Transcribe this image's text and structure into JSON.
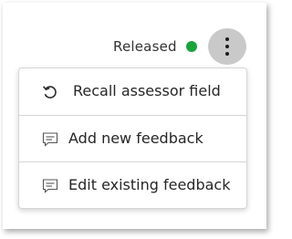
{
  "status": {
    "label": "Released",
    "dot_color": "#1aa33b"
  },
  "more_button": {
    "icon": "vertical-ellipsis-icon"
  },
  "menu": {
    "items": [
      {
        "label": "Recall assessor field",
        "icon": "undo-icon"
      },
      {
        "label": "Add new feedback",
        "icon": "comment-icon"
      },
      {
        "label": "Edit existing feedback",
        "icon": "comment-icon"
      }
    ]
  }
}
